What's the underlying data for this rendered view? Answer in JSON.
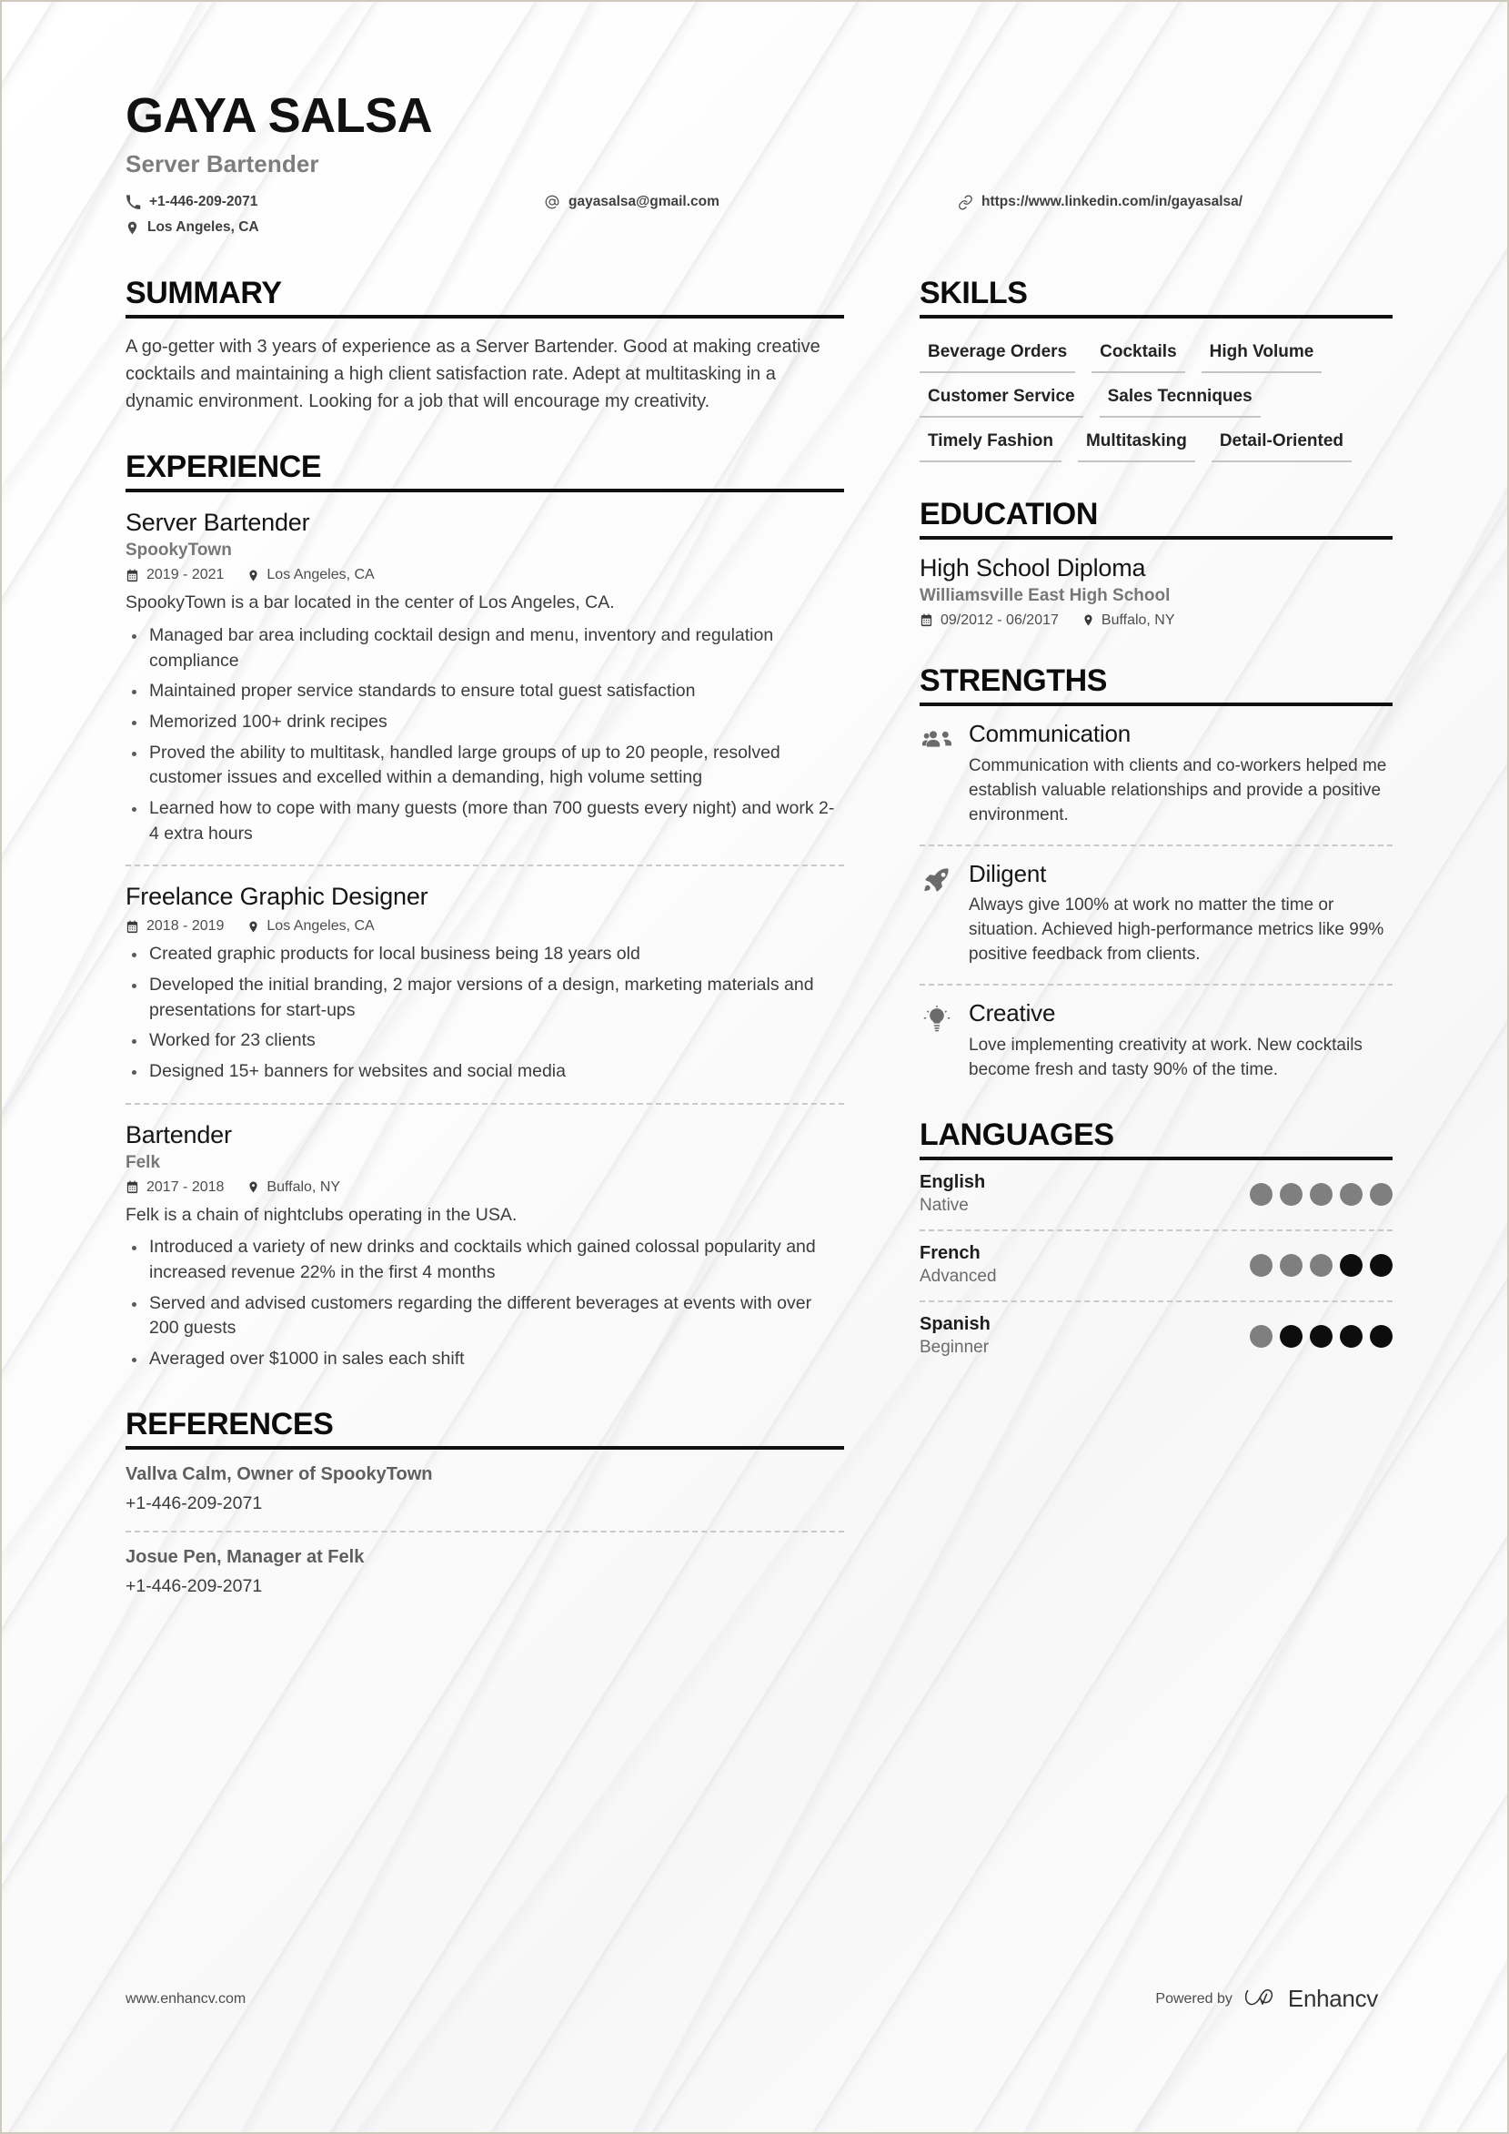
{
  "header": {
    "name": "GAYA SALSA",
    "role": "Server Bartender",
    "phone": "+1-446-209-2071",
    "email": "gayasalsa@gmail.com",
    "linkedin": "https://www.linkedin.com/in/gayasalsa/",
    "location": "Los Angeles, CA"
  },
  "summary": {
    "title": "SUMMARY",
    "text": "A go-getter with 3 years of experience as a Server Bartender. Good at making creative cocktails and maintaining a high client satisfaction rate. Adept at multitasking in a dynamic environment. Looking for a job that will encourage my creativity."
  },
  "experience": {
    "title": "EXPERIENCE",
    "jobs": [
      {
        "title": "Server Bartender",
        "company": "SpookyTown",
        "dates": "2019 - 2021",
        "location": "Los Angeles, CA",
        "description": "SpookyTown is a bar located in the center of Los Angeles, CA.",
        "bullets": [
          "Managed bar area including cocktail design and menu, inventory and regulation compliance",
          "Maintained proper service standards to ensure total guest satisfaction",
          "Memorized 100+ drink recipes",
          "Proved the ability to multitask, handled large groups of up to 20 people, resolved customer issues and excelled within a demanding, high volume setting",
          "Learned how to cope with many guests (more than 700 guests every night) and work 2-4 extra hours"
        ]
      },
      {
        "title": "Freelance Graphic Designer",
        "company": "",
        "dates": "2018 - 2019",
        "location": "Los Angeles, CA",
        "description": "",
        "bullets": [
          "Created graphic products for local business being 18 years old",
          "Developed the initial branding, 2 major versions of a design, marketing materials and presentations for start-ups",
          "Worked for 23 clients",
          "Designed 15+ banners for websites and social media"
        ]
      },
      {
        "title": "Bartender",
        "company": "Felk",
        "dates": "2017 - 2018",
        "location": "Buffalo, NY",
        "description": "Felk is a chain of nightclubs operating in the USA.",
        "bullets": [
          "Introduced a variety of new drinks and cocktails which gained colossal popularity and increased revenue 22% in the first 4 months",
          "Served and advised customers regarding the different beverages at events with over 200 guests",
          "Averaged over $1000 in sales each shift"
        ]
      }
    ]
  },
  "references": {
    "title": "REFERENCES",
    "items": [
      {
        "name": "Vallva Calm, Owner of SpookyTown",
        "phone": "+1-446-209-2071"
      },
      {
        "name": "Josue Pen, Manager at Felk",
        "phone": "+1-446-209-2071"
      }
    ]
  },
  "skills": {
    "title": "SKILLS",
    "items": [
      "Beverage Orders",
      "Cocktails",
      "High Volume",
      "Customer Service",
      "Sales Tecnniques",
      "Timely Fashion",
      "Multitasking",
      "Detail-Oriented"
    ]
  },
  "education": {
    "title": "EDUCATION",
    "items": [
      {
        "degree": "High School Diploma",
        "school": "Williamsville East High School",
        "dates": "09/2012 - 06/2017",
        "location": "Buffalo, NY"
      }
    ]
  },
  "strengths": {
    "title": "STRENGTHS",
    "items": [
      {
        "icon": "people-group-icon",
        "name": "Communication",
        "description": "Communication with clients and co-workers helped me establish valuable relationships and provide a positive environment."
      },
      {
        "icon": "rocket-icon",
        "name": "Diligent",
        "description": "Always give 100% at work no matter the time or situation. Achieved high-performance metrics like 99% positive feedback from clients."
      },
      {
        "icon": "lightbulb-icon",
        "name": "Creative",
        "description": "Love implementing creativity at work. New cocktails become fresh and tasty 90% of the time."
      }
    ]
  },
  "languages": {
    "title": "LANGUAGES",
    "total_dots": 5,
    "items": [
      {
        "name": "English",
        "level": "Native",
        "filled": 5
      },
      {
        "name": "French",
        "level": "Advanced",
        "filled": 3
      },
      {
        "name": "Spanish",
        "level": "Beginner",
        "filled": 1
      }
    ]
  },
  "footer": {
    "url": "www.enhancv.com",
    "powered_by": "Powered by",
    "brand": "Enhancv"
  },
  "colors": {
    "ink": "#111111",
    "muted": "#7d7d7d",
    "body": "#3c3c3c",
    "dot_filled": "#7f7f7f",
    "dot_empty": "#0d0d0d"
  }
}
